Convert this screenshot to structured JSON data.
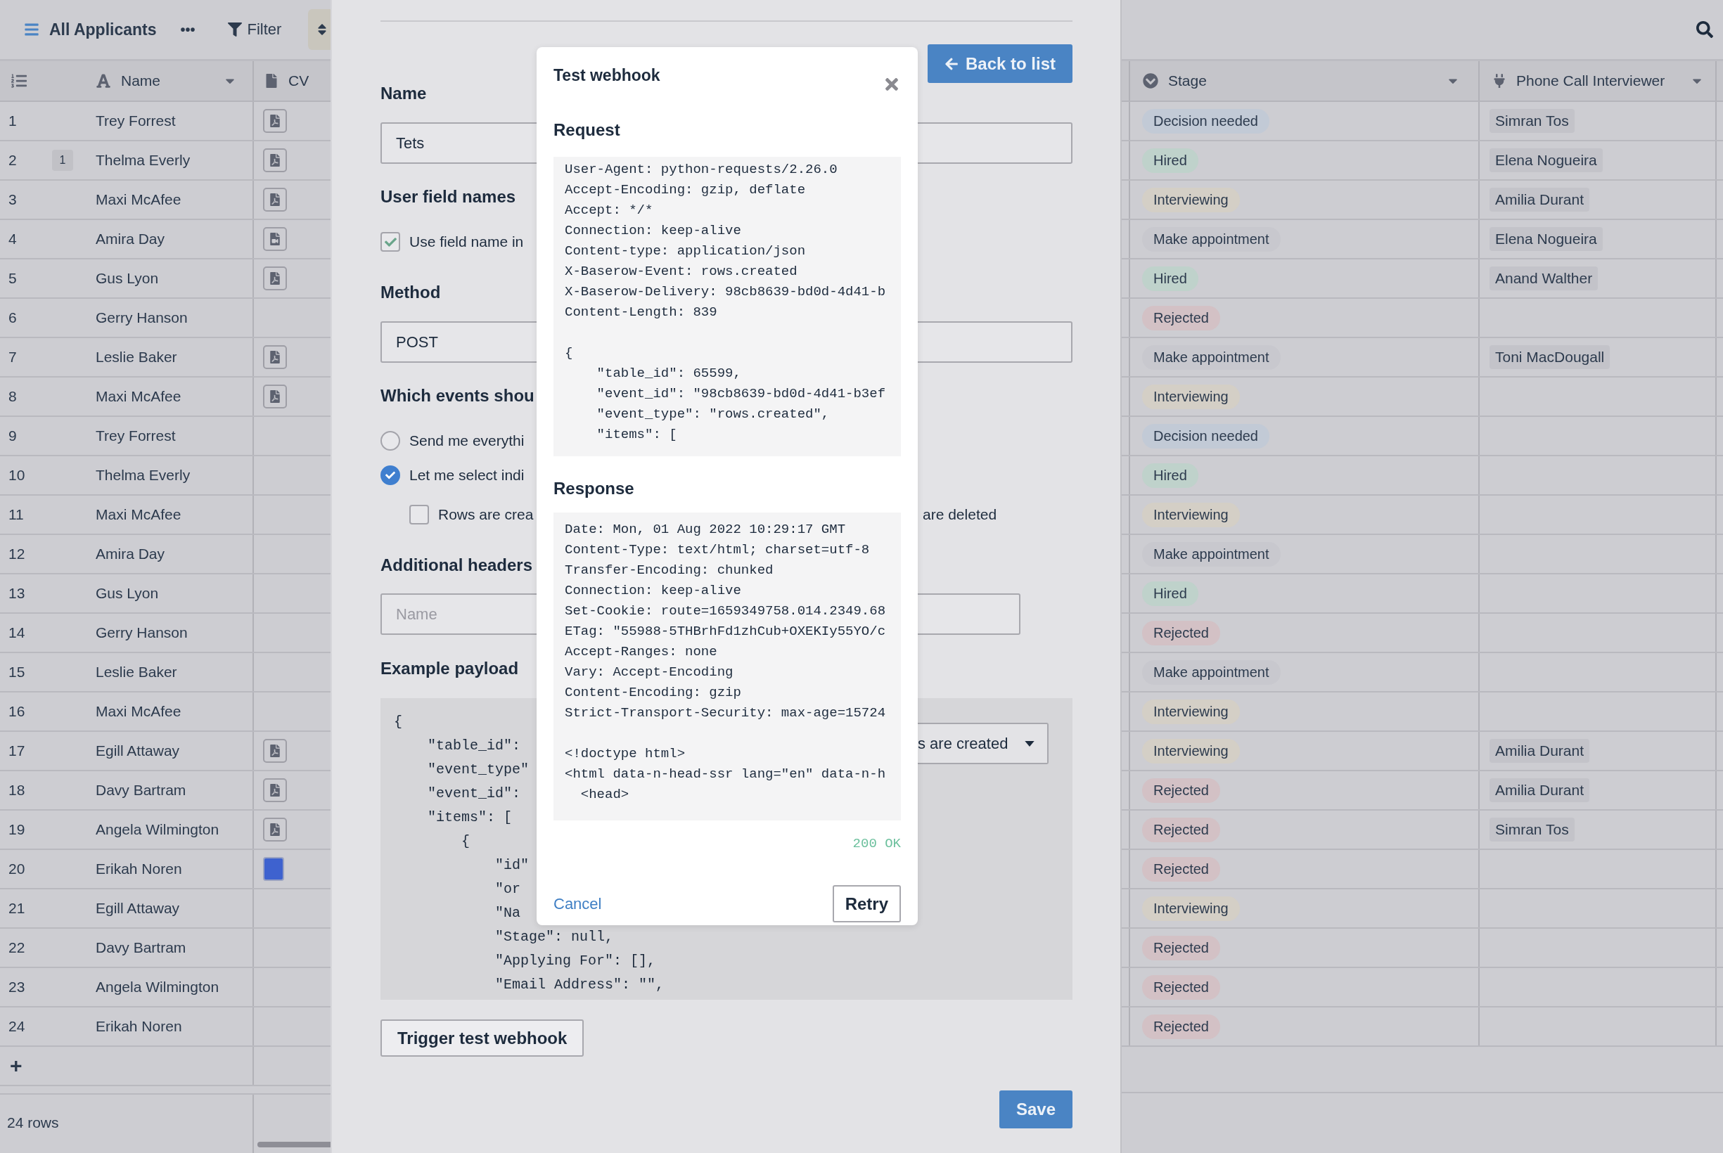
{
  "toolbar": {
    "view": "All Applicants",
    "more": "•••",
    "filter": "Filter"
  },
  "grid": {
    "columns": [
      "Name",
      "CV",
      "Stage",
      "Phone Call Interviewer"
    ],
    "rows": [
      {
        "id": "1",
        "name": "Trey Forrest",
        "cv": {
          "kind": "pdf"
        },
        "stage": {
          "label": "Decision needed",
          "color": "#c2cad6"
        },
        "interviewer": "Simran Tos"
      },
      {
        "id": "2",
        "comments": "1",
        "name": "Thelma Everly",
        "cv": {
          "kind": "pdf"
        },
        "stage": {
          "label": "Hired",
          "color": "#bfd2cb"
        },
        "interviewer": "Elena Nogueira"
      },
      {
        "id": "3",
        "name": "Maxi McAfee",
        "cv": {
          "kind": "pdf"
        },
        "stage": {
          "label": "Interviewing",
          "color": "#d4cfc6"
        },
        "interviewer": "Amilia Durant"
      },
      {
        "id": "4",
        "name": "Amira Day",
        "cv": {
          "kind": "video"
        },
        "stage": {
          "label": "Make appointment",
          "color": "#c8c8ce"
        },
        "interviewer": "Elena Nogueira"
      },
      {
        "id": "5",
        "name": "Gus Lyon",
        "cv": {
          "kind": "pdf"
        },
        "stage": {
          "label": "Hired",
          "color": "#bfd2cb"
        },
        "interviewer": "Anand Walther"
      },
      {
        "id": "6",
        "name": "Gerry Hanson",
        "stage": {
          "label": "Rejected",
          "color": "#d3c1c5"
        }
      },
      {
        "id": "7",
        "name": "Leslie Baker",
        "cv": {
          "kind": "pdf"
        },
        "stage": {
          "label": "Make appointment",
          "color": "#c8c8ce"
        },
        "interviewer": "Toni MacDougall"
      },
      {
        "id": "8",
        "name": "Maxi McAfee",
        "cv": {
          "kind": "pdf"
        },
        "stage": {
          "label": "Interviewing",
          "color": "#d4cfc6"
        }
      },
      {
        "id": "9",
        "name": "Trey Forrest",
        "stage": {
          "label": "Decision needed",
          "color": "#c2cad6"
        }
      },
      {
        "id": "10",
        "name": "Thelma Everly",
        "stage": {
          "label": "Hired",
          "color": "#bfd2cb"
        }
      },
      {
        "id": "11",
        "name": "Maxi McAfee",
        "stage": {
          "label": "Interviewing",
          "color": "#d4cfc6"
        }
      },
      {
        "id": "12",
        "name": "Amira Day",
        "stage": {
          "label": "Make appointment",
          "color": "#c8c8ce"
        }
      },
      {
        "id": "13",
        "name": "Gus Lyon",
        "stage": {
          "label": "Hired",
          "color": "#bfd2cb"
        }
      },
      {
        "id": "14",
        "name": "Gerry Hanson",
        "stage": {
          "label": "Rejected",
          "color": "#d3c1c5"
        }
      },
      {
        "id": "15",
        "name": "Leslie Baker",
        "stage": {
          "label": "Make appointment",
          "color": "#c8c8ce"
        }
      },
      {
        "id": "16",
        "name": "Maxi McAfee",
        "stage": {
          "label": "Interviewing",
          "color": "#d4cfc6"
        }
      },
      {
        "id": "17",
        "name": "Egill Attaway",
        "cv": {
          "kind": "pdf"
        },
        "stage": {
          "label": "Interviewing",
          "color": "#d4cfc6"
        },
        "interviewer": "Amilia Durant"
      },
      {
        "id": "18",
        "name": "Davy Bartram",
        "cv": {
          "kind": "pdf"
        },
        "stage": {
          "label": "Rejected",
          "color": "#d3c1c5"
        },
        "interviewer": "Amilia Durant"
      },
      {
        "id": "19",
        "name": "Angela Wilmington",
        "cv": {
          "kind": "pdf"
        },
        "stage": {
          "label": "Rejected",
          "color": "#d3c1c5"
        },
        "interviewer": "Simran Tos"
      },
      {
        "id": "20",
        "name": "Erikah Noren",
        "cv": {
          "kind": "image"
        },
        "stage": {
          "label": "Rejected",
          "color": "#d3c1c5"
        }
      },
      {
        "id": "21",
        "name": "Egill Attaway",
        "stage": {
          "label": "Interviewing",
          "color": "#d4cfc6"
        }
      },
      {
        "id": "22",
        "name": "Davy Bartram",
        "stage": {
          "label": "Rejected",
          "color": "#d3c1c5"
        }
      },
      {
        "id": "23",
        "name": "Angela Wilmington",
        "stage": {
          "label": "Rejected",
          "color": "#d3c1c5"
        }
      },
      {
        "id": "24",
        "name": "Erikah Noren",
        "stage": {
          "label": "Rejected",
          "color": "#d3c1c5"
        }
      }
    ],
    "add": "+",
    "count": "24 rows"
  },
  "form": {
    "name_label": "Name",
    "name_value": "Tets",
    "back": "Back to list",
    "field_names_label": "User field names",
    "use_field_names": {
      "label": "Use field name in",
      "checked": true
    },
    "method_label": "Method",
    "method_value": "POST",
    "events_label": "Which events shou",
    "event_modes": [
      {
        "label": "Send me everythi",
        "selected": false
      },
      {
        "label": "Let me select indi",
        "selected": true
      }
    ],
    "event_types": [
      {
        "label": "Rows are crea",
        "checked": false
      }
    ],
    "event_types_tail": "are deleted",
    "headers_label": "Additional headers",
    "header_name_placeholder": "Name",
    "payload_label": "Example payload",
    "payload_lines": [
      "{",
      "    \"table_id\":",
      "    \"event_type\"",
      "    \"event_id\":",
      "    \"items\": [",
      "        {",
      "            \"id\"",
      "            \"or",
      "            \"Na",
      "            \"Stage\": null,",
      "            \"Applying For\": [],",
      "            \"Email Address\": \"\","
    ],
    "event_select": "s are created",
    "trigger": "Trigger test webhook",
    "save": "Save"
  },
  "modal": {
    "title": "Test webhook",
    "request_label": "Request",
    "request": {
      "headers": [
        "User-Agent: python-requests/2.26.0",
        "Accept-Encoding: gzip, deflate",
        "Accept: */*",
        "Connection: keep-alive",
        "Content-type: application/json",
        "X-Baserow-Event: rows.created",
        "X-Baserow-Delivery: 98cb8639-bd0d-4d41-b",
        "Content-Length: 839"
      ],
      "body": [
        "{",
        "    \"table_id\": 65599,",
        "    \"event_id\": \"98cb8639-bd0d-4d41-b3ef",
        "    \"event_type\": \"rows.created\",",
        "    \"items\": ["
      ]
    },
    "response_label": "Response",
    "response": {
      "headers": [
        "Date: Mon, 01 Aug 2022 10:29:17 GMT",
        "Content-Type: text/html; charset=utf-8",
        "Transfer-Encoding: chunked",
        "Connection: keep-alive",
        "Set-Cookie: route=1659349758.014.2349.68",
        "ETag: \"55988-5THBrhFd1zhCub+OXEKIy55YO/c",
        "Accept-Ranges: none",
        "Vary: Accept-Encoding",
        "Content-Encoding: gzip",
        "Strict-Transport-Security: max-age=15724"
      ],
      "body": [
        "<!doctype html>",
        "<html data-n-head-ssr lang=\"en\" data-n-h",
        "  <head>"
      ]
    },
    "status": "200 OK",
    "cancel": "Cancel",
    "retry": "Retry"
  }
}
